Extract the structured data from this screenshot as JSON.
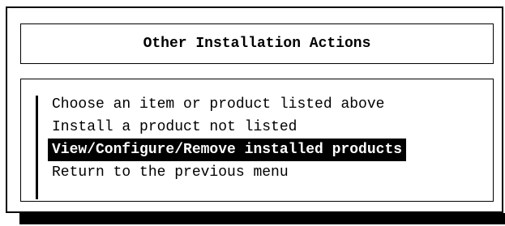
{
  "dialog": {
    "title": "Other Installation Actions"
  },
  "menu": {
    "items": [
      {
        "label": "Choose an item or product listed above",
        "selected": false
      },
      {
        "label": "Install a product not listed",
        "selected": false
      },
      {
        "label": "View/Configure/Remove installed products",
        "selected": true
      },
      {
        "label": "Return to the previous menu",
        "selected": false
      }
    ]
  },
  "colors": {
    "background": "#ffffff",
    "foreground": "#000000",
    "selection_background": "#000000",
    "selection_foreground": "#ffffff"
  }
}
